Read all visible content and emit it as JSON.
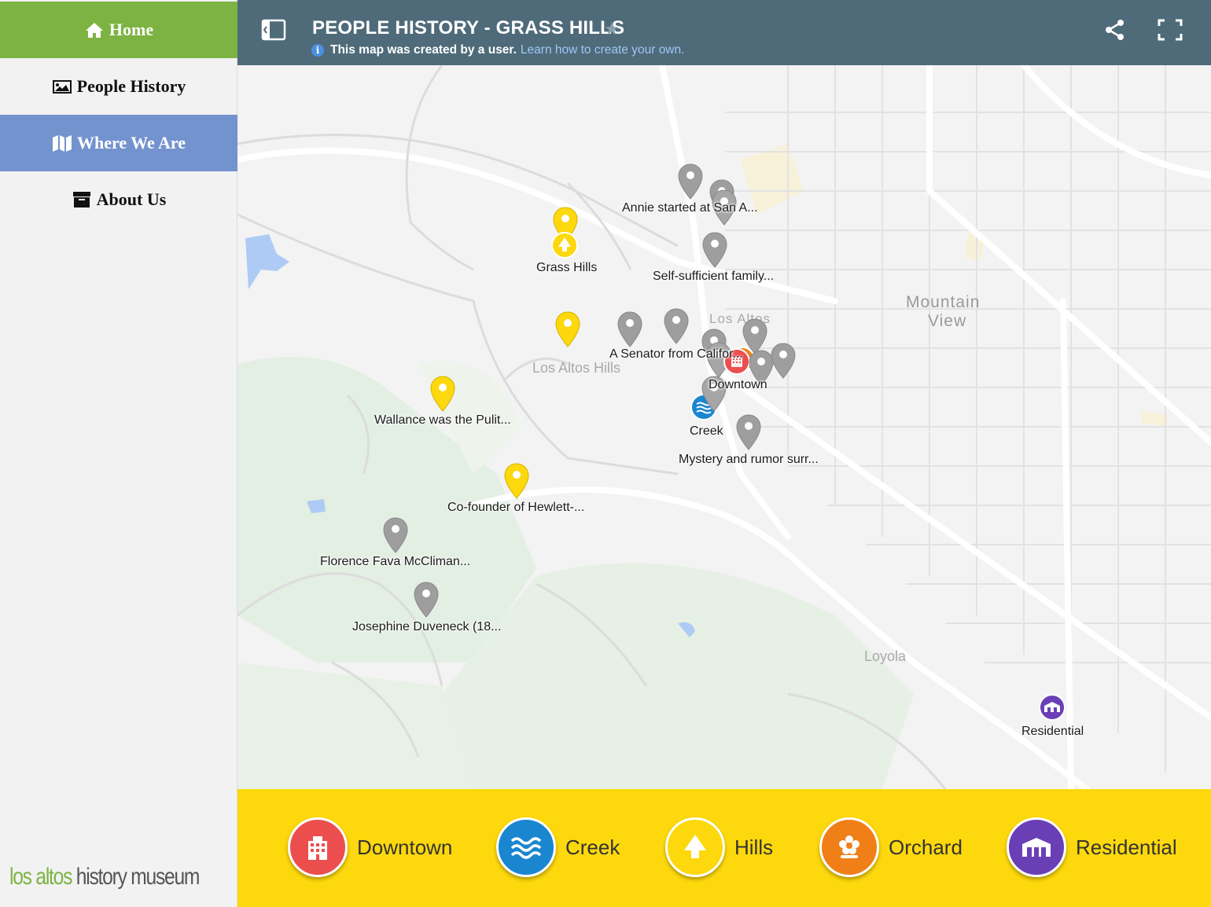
{
  "sidebar": {
    "items": [
      {
        "label": "Home",
        "icon": "home-icon",
        "active": false
      },
      {
        "label": "People History",
        "icon": "image-icon",
        "active": false
      },
      {
        "label": "Where We Are",
        "icon": "map-icon",
        "active": true
      },
      {
        "label": "About Us",
        "icon": "archive-icon",
        "active": false
      }
    ],
    "logo": {
      "part1": "los altos",
      "part2": "history museum"
    }
  },
  "header": {
    "title": "PEOPLE HISTORY - GRASS HILLS",
    "info_text": "This map was created by a user.",
    "info_link": "Learn how to create your own."
  },
  "map": {
    "place_labels": {
      "mountain_view_1": "Mountain",
      "mountain_view_2": "View",
      "los_altos": "Los Altos",
      "los_altos_hills": "Los Altos Hills",
      "loyola": "Loyola"
    },
    "pins": {
      "annie": "Annie started at San A...",
      "grass_hills": "Grass Hills",
      "self_sufficient": "Self-sufficient family...",
      "senator": "A Senator from Califor...",
      "downtown": "Downtown",
      "wallance": "Wallance was the Pulit...",
      "creek": "Creek",
      "mystery": "Mystery and rumor surr...",
      "cofounder": "Co-founder of Hewlett-...",
      "florence": "Florence Fava McCliman...",
      "josephine": "Josephine Duveneck (18...",
      "residential": "Residential"
    }
  },
  "legend": {
    "items": [
      {
        "label": "Downtown",
        "color": "#ec4e4e",
        "icon": "building-icon"
      },
      {
        "label": "Creek",
        "color": "#1a86d0",
        "icon": "waves-icon"
      },
      {
        "label": "Hills",
        "color": "#fdd80c",
        "icon": "tree-icon"
      },
      {
        "label": "Orchard",
        "color": "#f07f17",
        "icon": "flower-icon"
      },
      {
        "label": "Residential",
        "color": "#6a3fb5",
        "icon": "houses-icon"
      }
    ]
  },
  "colors": {
    "home_bg": "#7cb342",
    "active_bg": "#7393cf",
    "header_bg": "#4f6b7a",
    "legend_bg": "#fdd80c",
    "pin_gray": "#9e9e9e",
    "pin_yellow": "#fdd80c"
  }
}
